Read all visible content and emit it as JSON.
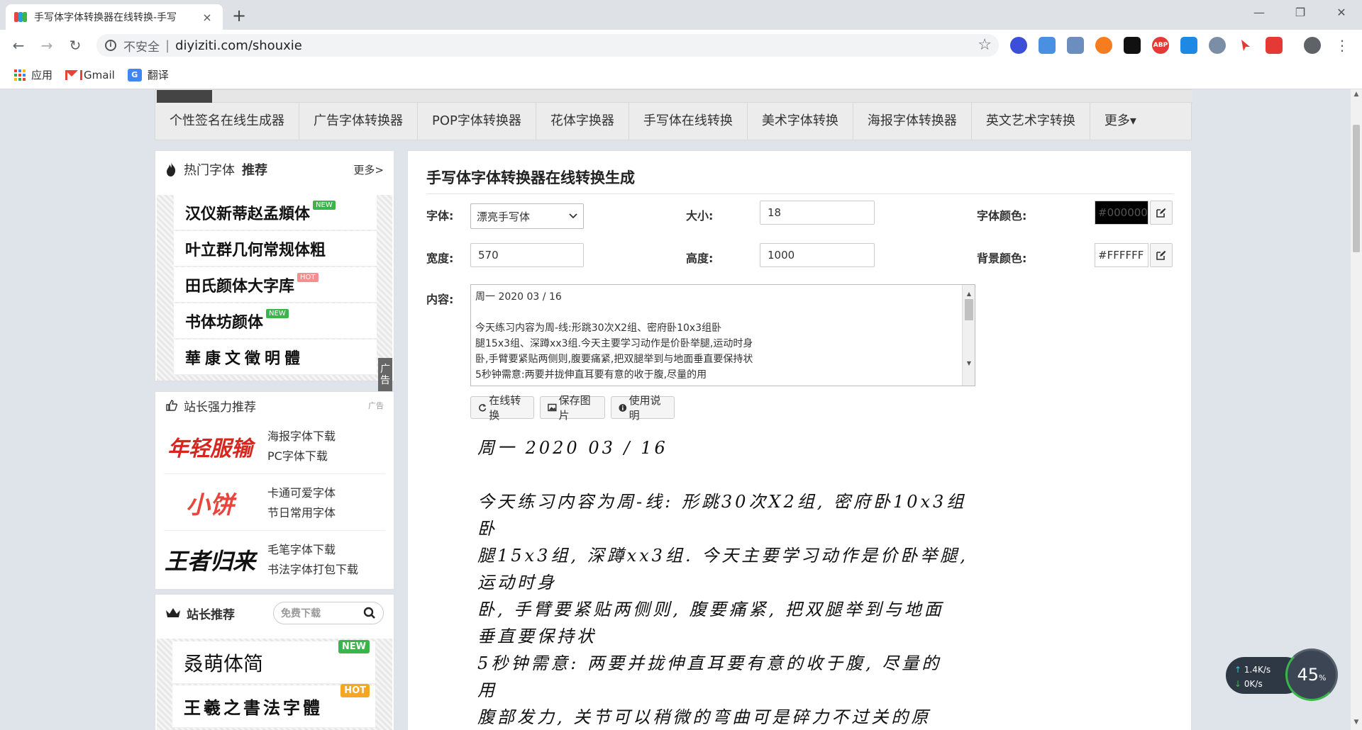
{
  "browser": {
    "tab_title": "手写体字体转换器在线转换-手写",
    "tab_close": "×",
    "new_tab": "+",
    "win_min": "—",
    "win_max": "❐",
    "win_close": "✕",
    "insecure_label": "不安全",
    "separator": "|",
    "url": "diyiziti.com/shouxie",
    "bookmarks": {
      "apps": "应用",
      "gmail": "Gmail",
      "translate": "翻译"
    }
  },
  "topnav": {
    "items": [
      "个性签名在线生成器",
      "广告字体转换器",
      "POP字体转换器",
      "花体字换器",
      "手写体在线转换",
      "美术字体转换",
      "海报字体转换器",
      "英文艺术字转换",
      "更多▾"
    ]
  },
  "hot_fonts": {
    "title": "热门字体",
    "title_bold": "推荐",
    "more": "更多>",
    "items": [
      {
        "name": "汉仪新蒂赵孟頫体",
        "badge": "NEW"
      },
      {
        "name": "叶立群几何常规体粗",
        "badge": ""
      },
      {
        "name": "田氏颜体大字库",
        "badge": "HOT"
      },
      {
        "name": "书体坊颜体",
        "badge": "NEW"
      },
      {
        "name": "華康文徵明體",
        "badge": ""
      }
    ],
    "ad_label": "广告"
  },
  "recommend": {
    "title": "站长强力推荐",
    "ad": "广告",
    "rows": [
      {
        "logo": "年轻服输",
        "link1": "海报字体下载",
        "link2": "PC字体下载"
      },
      {
        "logo": "小饼",
        "link1": "卡通可爱字体",
        "link2": "节日常用字体"
      },
      {
        "logo": "王者归来",
        "link1": "毛笔字体下载",
        "link2": "书法字体打包下载"
      }
    ]
  },
  "recommend2": {
    "title": "站长推荐",
    "search_placeholder": "免费下载",
    "items": [
      {
        "name": "叒萌体简",
        "badge": "NEW"
      },
      {
        "name": "王羲之書法字體",
        "badge": "HOT"
      }
    ]
  },
  "main": {
    "title": "手写体字体转换器在线转换生成",
    "font_label": "字体:",
    "font_value": "漂亮手写体",
    "size_label": "大小:",
    "size_value": "18",
    "color_label": "字体颜色:",
    "color_value": "#000000",
    "width_label": "宽度:",
    "width_value": "570",
    "height_label": "高度:",
    "height_value": "1000",
    "bg_label": "背景颜色:",
    "bg_value": "#FFFFFF",
    "content_label": "内容:",
    "content_lines": [
      "周一 2020 03 / 16",
      "",
      "今天练习内容为周-线:形跳30次X2组、密府卧10x3组卧",
      "腿15x3组、深蹲xx3组.今天主要学习动作是价卧举腿,运动时身",
      "卧,手臂要紧贴两侧则,腹要痛紧,把双腿举到与地面垂直要保持状",
      "5秒钟需意:两要并拢伸直耳要有意的收于腹,尽量的用"
    ],
    "btn_convert": "在线转换",
    "btn_save": "保存图片",
    "btn_help": "使用说明",
    "result_lines": [
      "周一 2020 03 / 16",
      "",
      "今天练习内容为周-线: 形跳30次X2组, 密府卧10x3组",
      "卧",
      "腿15x3组, 深蹲xx3组. 今天主要学习动作是价卧举腿,",
      "运动时身",
      "卧, 手臂要紧贴两侧则, 腹要痛紧, 把双腿举到与地面",
      "垂直要保持状",
      "5秒钟需意: 两要并拢伸直耳要有意的收于腹, 尽量的",
      "用",
      "腹部发力, 关节可以稍微的弯曲可是碎力不过关的原"
    ]
  },
  "speed_widget": {
    "up": "1.4K/s",
    "down": "0K/s",
    "percent": "45",
    "percent_unit": "%"
  },
  "colors": {
    "accent_green": "#3bb54a",
    "hot_badge": "#f58f8f",
    "page_bg": "#dfe3ea"
  }
}
